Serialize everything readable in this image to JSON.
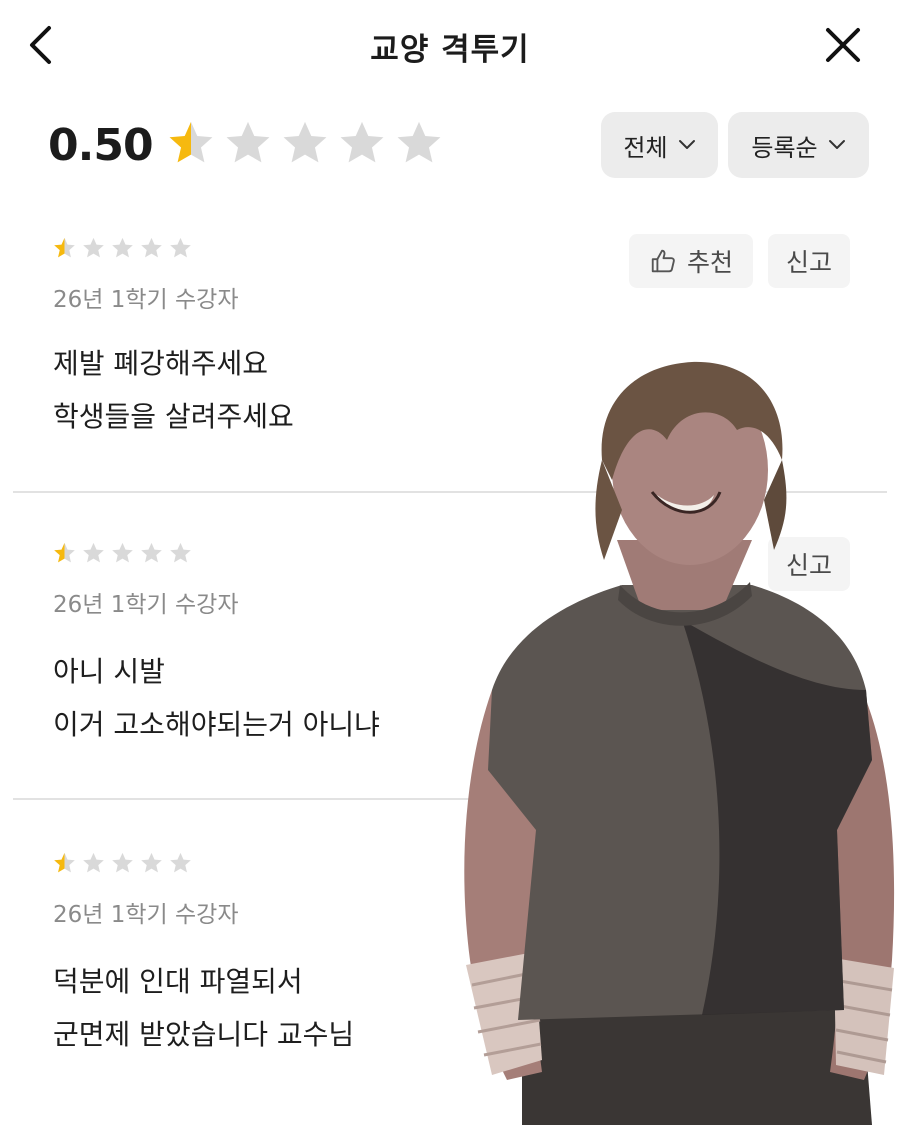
{
  "header": {
    "title": "교양 격투기",
    "back_icon": "chevron-left-icon",
    "close_icon": "close-icon"
  },
  "summary": {
    "score": "0.50",
    "rating": 0.5,
    "max_rating": 5,
    "filter_label": "전체",
    "sort_label": "등록순"
  },
  "colors": {
    "star_filled": "#f6b90f",
    "star_empty": "#d9d9d9",
    "pill_bg": "#f4f4f4"
  },
  "reviews": [
    {
      "rating": 0.5,
      "meta": "26년 1학기 수강자",
      "line1": "제발 폐강해주세요",
      "line2": "학생들을 살려주세요",
      "recommend_label": "추천",
      "report_label": "신고"
    },
    {
      "rating": 0.5,
      "meta": "26년 1학기 수강자",
      "line1": "아니 시발",
      "line2": "이거 고소해야되는거 아니냐",
      "report_label": "신고"
    },
    {
      "rating": 0.5,
      "meta": "26년 1학기 수강자",
      "line1": "덕분에 인대 파열되서",
      "line2": "군면제 받았습니다 교수님"
    }
  ]
}
